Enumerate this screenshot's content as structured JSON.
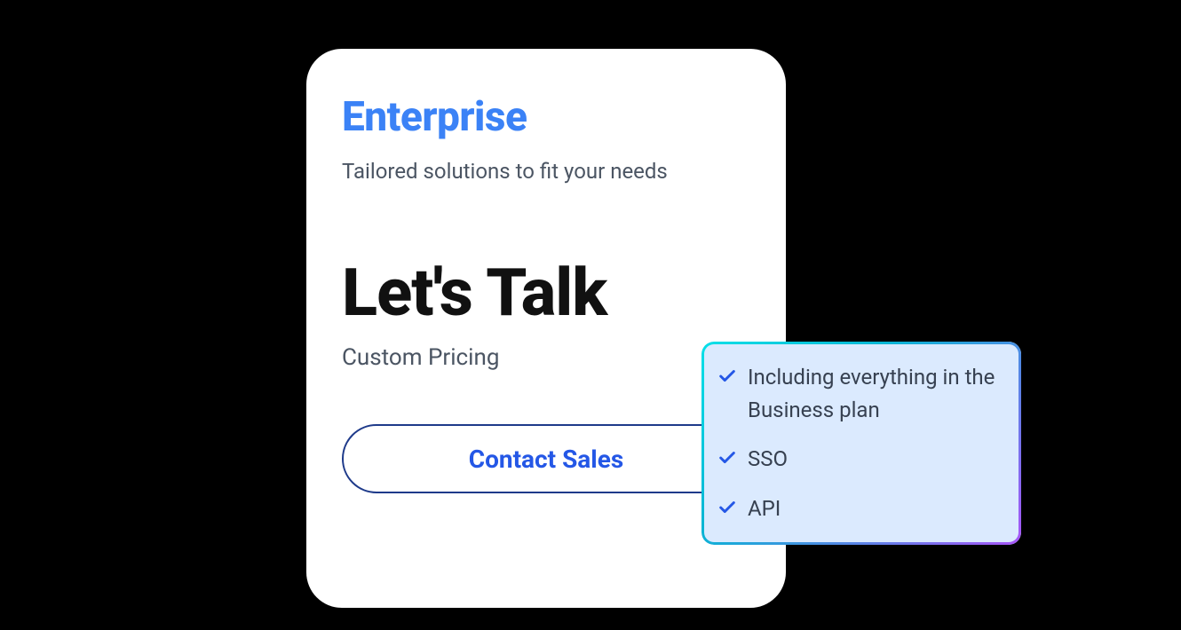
{
  "plan": {
    "name": "Enterprise",
    "tagline": "Tailored solutions to fit your needs",
    "headline": "Let's Talk",
    "pricing_note": "Custom Pricing",
    "cta_label": "Contact Sales"
  },
  "features": [
    "Including everything in the Business plan",
    "SSO",
    "API"
  ],
  "colors": {
    "accent": "#3b82f6",
    "button_text": "#2457e6",
    "button_border": "#1e3a8a",
    "feature_bg": "#dbeafe"
  }
}
